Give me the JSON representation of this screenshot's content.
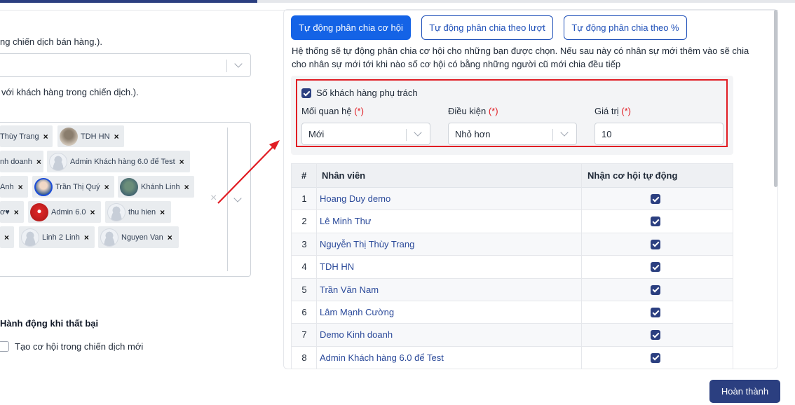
{
  "left": {
    "campaign_desc": "ng chiến dịch bán hàng.).",
    "select_value": "",
    "customers_desc": "với khách hàng trong chiến dịch.).",
    "chips": [
      {
        "label": "Thùy Trang",
        "avatar": "none"
      },
      {
        "label": "TDH HN",
        "avatar": "photo"
      },
      {
        "label": "nh doanh",
        "avatar": "none"
      },
      {
        "label": "Admin Khách hàng 6.0 để Test",
        "avatar": "default"
      },
      {
        "label": "Anh",
        "avatar": "none"
      },
      {
        "label": "Trần Thị Quý",
        "avatar": "photo"
      },
      {
        "label": "Khánh Linh",
        "avatar": "photo"
      },
      {
        "label": "ơ♥",
        "avatar": "none"
      },
      {
        "label": "Admin 6.0",
        "avatar": "photo"
      },
      {
        "label": "thu hien",
        "avatar": "default"
      },
      {
        "label": "",
        "avatar": "none"
      },
      {
        "label": "Linh 2 Linh",
        "avatar": "default"
      },
      {
        "label": "Nguyen Van",
        "avatar": "default"
      }
    ],
    "chip_remove": "×",
    "clear_icon": "×",
    "fail_section_title": "Hành động khi thất bại",
    "fail_option_label": "Tạo cơ hội trong chiến dịch mới"
  },
  "tabs": [
    {
      "label": "Tự động phân chia cơ hội",
      "active": true
    },
    {
      "label": "Tự động phân chia theo lượt",
      "active": false
    },
    {
      "label": "Tự động phân chia theo %",
      "active": false
    }
  ],
  "info_line1": "Hệ thống sẽ tự động phân chia cơ hội cho những bạn được chọn. Nếu sau này có nhân sự mới thêm vào sẽ chia",
  "info_line2": "cho nhân sự mới tới khi nào số cơ hội có bằng những người cũ mới chia đều tiếp",
  "config": {
    "checkbox_label": "Số khách hàng phụ trách",
    "relation_label": "Mối quan hệ",
    "condition_label": "Điều kiện",
    "value_label": "Giá trị",
    "required_mark": "(*)",
    "relation_value": "Mới",
    "condition_value": "Nhỏ hơn",
    "value_value": "10"
  },
  "table": {
    "headers": {
      "num": "#",
      "employee": "Nhân viên",
      "auto": "Nhận cơ hội tự động"
    },
    "rows": [
      {
        "num": "1",
        "name": "Hoang Duy demo",
        "checked": true
      },
      {
        "num": "2",
        "name": "Lê Minh Thư",
        "checked": true
      },
      {
        "num": "3",
        "name": "Nguyễn Thị Thùy Trang",
        "checked": true
      },
      {
        "num": "4",
        "name": "TDH HN",
        "checked": true
      },
      {
        "num": "5",
        "name": "Trần Văn Nam",
        "checked": true
      },
      {
        "num": "6",
        "name": "Lâm Mạnh Cường",
        "checked": true
      },
      {
        "num": "7",
        "name": "Demo Kinh doanh",
        "checked": true
      },
      {
        "num": "8",
        "name": "Admin Khách hàng 6.0 để Test",
        "checked": true
      }
    ]
  },
  "finish_label": "Hoàn thành",
  "colors": {
    "primary": "#1463e6",
    "navy": "#2b3f80",
    "highlight": "#e11d24",
    "link": "#2b4a9a"
  }
}
